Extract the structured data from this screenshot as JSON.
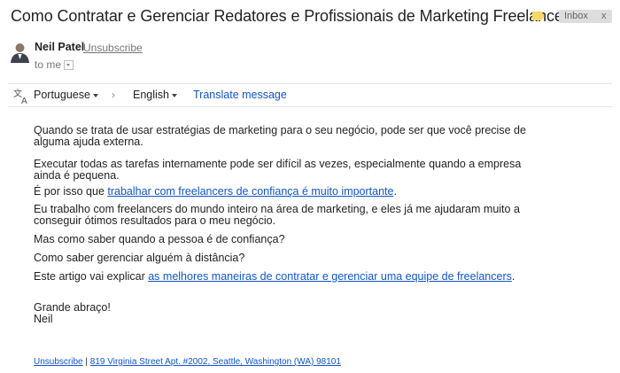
{
  "header": {
    "subject": "Como Contratar e Gerenciar Redatores e Profissionais de Marketing Freelancer",
    "label_chip": "Inbox",
    "label_chip_close": "x",
    "label_color": "#f8d866"
  },
  "sender": {
    "name": "Neil Patel",
    "unsubscribe": "Unsubscribe",
    "to": "to me"
  },
  "translate": {
    "source_language": "Portuguese",
    "target_language": "English",
    "arrow": "›",
    "action": "Translate message"
  },
  "body": {
    "p1": "Quando se trata de usar estratégias de marketing para o seu negócio, pode ser que você precise de alguma ajuda externa.",
    "p2": "Executar todas as tarefas internamente pode ser difícil as vezes, especialmente quando a empresa ainda é pequena.",
    "p3_prefix": "É por isso que ",
    "p3_link": "trabalhar com freelancers de confiança é muito importante",
    "p3_suffix": ".",
    "p4": "Eu trabalho com freelancers do mundo inteiro na área de marketing, e eles já me ajudaram muito a conseguir ótimos resultados para o meu negócio.",
    "p5": "Mas como saber quando a pessoa é de confiança?",
    "p6": "Como saber gerenciar alguém à distância?",
    "p7_prefix": "Este artigo vai explicar ",
    "p7_link": "as melhores maneiras de contratar e gerenciar uma equipe de freelancers",
    "p7_suffix": ".",
    "closing": "Grande abraço!",
    "signature": "Neil"
  },
  "footer": {
    "unsubscribe": "Unsubscribe",
    "separator": "|",
    "address": "819 Virginia Street Apt. #2002, Seattle, Washington (WA) 98101"
  },
  "colors": {
    "link": "#1155cc",
    "chip_bg": "#dddddd"
  }
}
